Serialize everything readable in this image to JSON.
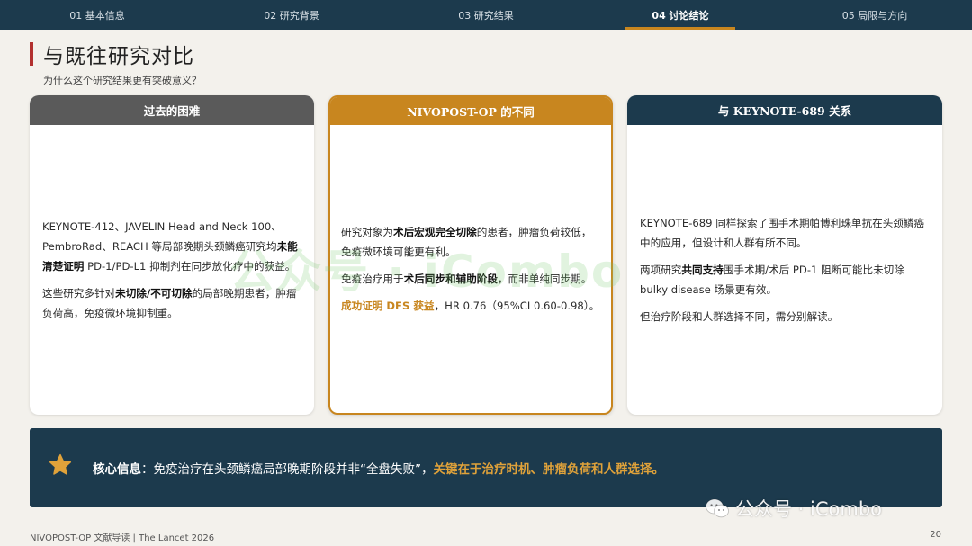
{
  "nav": {
    "tabs": [
      {
        "label": "01 基本信息"
      },
      {
        "label": "02 研究背景"
      },
      {
        "label": "03 研究结果"
      },
      {
        "label": "04 讨论结论"
      },
      {
        "label": "05 局限与方向"
      }
    ],
    "active_index": 3
  },
  "header": {
    "title": "与既往研究对比",
    "subtitle": "为什么这个研究结果更有突破意义？"
  },
  "cards": [
    {
      "title": "过去的困难",
      "paragraphs": [
        [
          "KEYNOTE-412、JAVELIN Head and Neck 100、PembroRad、REACH 等局部晚期头颈鳞癌研究均",
          "未能清楚证明",
          " PD-1/PD-L1 抑制剂在同步放化疗中的获益。"
        ],
        [
          "这些研究多针对",
          "未切除/不可切除",
          "的局部晚期患者，肿瘤负荷高，免疫微环境抑制重。"
        ]
      ]
    },
    {
      "title": "NIVOPOST-OP 的不同",
      "paragraphs": [
        [
          "研究对象为",
          "术后宏观完全切除",
          "的患者，肿瘤负荷较低，免疫微环境可能更有利。"
        ],
        [
          "免疫治疗用于",
          "术后同步和辅助阶段",
          "，而非单纯同步期。"
        ],
        [
          "成功证明 DFS 获益",
          "，HR 0.76（95%CI 0.60-0.98）。"
        ]
      ]
    },
    {
      "title": "与 KEYNOTE-689 关系",
      "paragraphs": [
        [
          "KEYNOTE-689 同样探索了围手术期帕博利珠单抗在头颈鳞癌中的应用，但设计和人群有所不同。"
        ],
        [
          "两项研究",
          "共同支持",
          "围手术期/术后 PD-1 阻断可能比未切除 bulky disease 场景更有效。"
        ],
        [
          "但治疗阶段和人群选择不同，需分别解读。"
        ]
      ]
    }
  ],
  "banner": {
    "label": "核心信息",
    "colon": "：",
    "text": "免疫治疗在头颈鳞癌局部晚期阶段并非“全盘失败”，",
    "highlight": "关键在于治疗时机、肿瘤负荷和人群选择。",
    "icon": "star-icon"
  },
  "watermark": {
    "center": "公众号 · iCombo",
    "corner": "公众号 · iCombo"
  },
  "footer": {
    "left": "NIVOPOST-OP 文献导读 | The Lancet 2026",
    "page": "20"
  },
  "colors": {
    "navy": "#1c3a4d",
    "gold": "#c8861f",
    "gray_header": "#5a5a5a",
    "title_accent": "#b2302f"
  }
}
